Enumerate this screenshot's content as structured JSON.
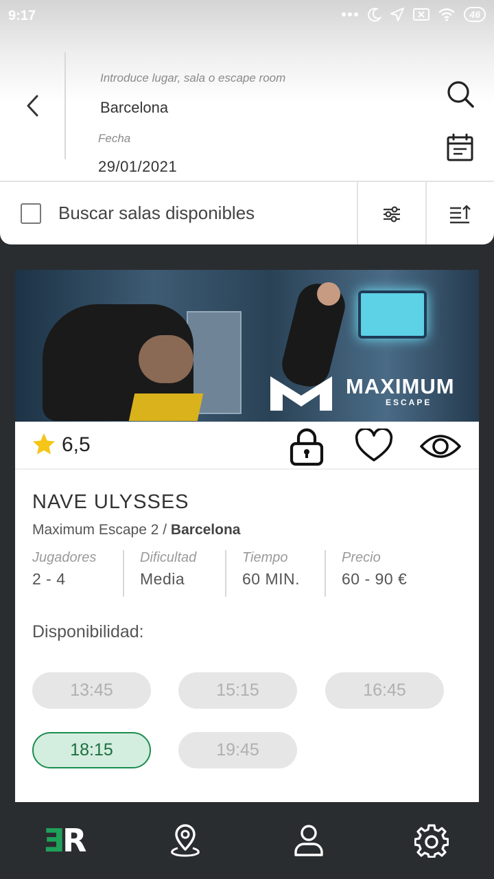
{
  "status_bar": {
    "time": "9:17",
    "battery": "46",
    "icons": [
      "dots-icon",
      "moon-icon",
      "location-arrow-icon",
      "sim-off-icon",
      "wifi-icon",
      "battery-icon"
    ]
  },
  "search": {
    "place_placeholder": "Introduce lugar, sala o escape room",
    "place_value": "Barcelona",
    "date_label": "Fecha",
    "date_value": "29/01/2021"
  },
  "filter_bar": {
    "available_label": "Buscar salas disponibles",
    "checkbox_checked": false,
    "icons": [
      "filter-sliders-icon",
      "sort-icon"
    ]
  },
  "room": {
    "rating": "6,5",
    "brand_logo": "MAXIMUM",
    "brand_sub": "ESCAPE",
    "name": "NAVE ULYSSES",
    "company": "Maximum Escape 2",
    "separator": " / ",
    "city": "Barcelona",
    "stats": {
      "players": {
        "label": "Jugadores",
        "value": "2 - 4"
      },
      "difficulty": {
        "label": "Dificultad",
        "value": "Media"
      },
      "time": {
        "label": "Tiempo",
        "value": "60 MIN."
      },
      "price": {
        "label": "Precio",
        "value": "60 - 90 €"
      }
    },
    "availability_label": "Disponibilidad:",
    "slots": [
      {
        "time": "13:45",
        "selected": false
      },
      {
        "time": "15:15",
        "selected": false
      },
      {
        "time": "16:45",
        "selected": false
      },
      {
        "time": "18:15",
        "selected": true
      },
      {
        "time": "19:45",
        "selected": false
      }
    ]
  },
  "bottom_nav": {
    "logo_e": "Ǝ",
    "logo_r": "R",
    "items": [
      "home-logo",
      "map-pin-icon",
      "user-icon",
      "settings-gear-icon"
    ]
  },
  "colors": {
    "accent_green": "#1c8c4e",
    "slot_selected_bg": "#d3eddf",
    "nav_bg": "#2a2d30",
    "star": "#f5c518"
  }
}
